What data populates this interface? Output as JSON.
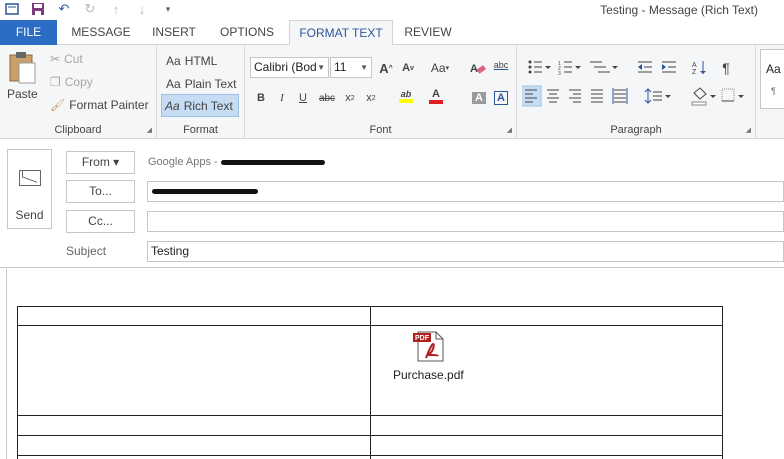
{
  "window": {
    "title": "Testing - Message (Rich Text)"
  },
  "qat": {
    "icons": [
      "outlook-icon",
      "save-icon",
      "undo-icon",
      "redo-icon",
      "up-icon",
      "down-icon",
      "customize-icon"
    ]
  },
  "tabs": [
    "FILE",
    "MESSAGE",
    "INSERT",
    "OPTIONS",
    "FORMAT TEXT",
    "REVIEW"
  ],
  "ribbon": {
    "clipboard": {
      "label": "Clipboard",
      "paste": "Paste",
      "cut": "Cut",
      "copy": "Copy",
      "format_painter": "Format Painter"
    },
    "format": {
      "label": "Format",
      "aa": "Aa",
      "html": "HTML",
      "plain": "Plain Text",
      "rich": "Rich Text"
    },
    "font": {
      "label": "Font",
      "family": "Calibri (Bod",
      "size": "11",
      "grow": "A",
      "shrink": "A",
      "case": "Aa",
      "bold": "B",
      "italic": "I",
      "underline": "U",
      "strike": "abc",
      "sub": "x",
      "sup": "x",
      "sub_mark": "2",
      "sup_mark": "2",
      "highlight": "ab",
      "color": "A",
      "shade": "A",
      "border": "A",
      "abc": "abc",
      "highlight_color": "#ffff00",
      "font_color": "#e02020"
    },
    "paragraph": {
      "label": "Paragraph",
      "pilcrow": "¶"
    },
    "styles": {
      "aa": "Aa",
      "pilcrow": "¶"
    }
  },
  "compose": {
    "send": "Send",
    "from": "From ▾",
    "from_account": "Google Apps - ",
    "to": "To...",
    "cc": "Cc...",
    "subject_label": "Subject",
    "subject": "Testing"
  },
  "body": {
    "attachment": "Purchase.pdf",
    "pdf_badge": "PDF"
  },
  "colors": {
    "accent": "#2b579a",
    "file_tab": "#2b6cc4",
    "selected": "#c5dcf2"
  }
}
